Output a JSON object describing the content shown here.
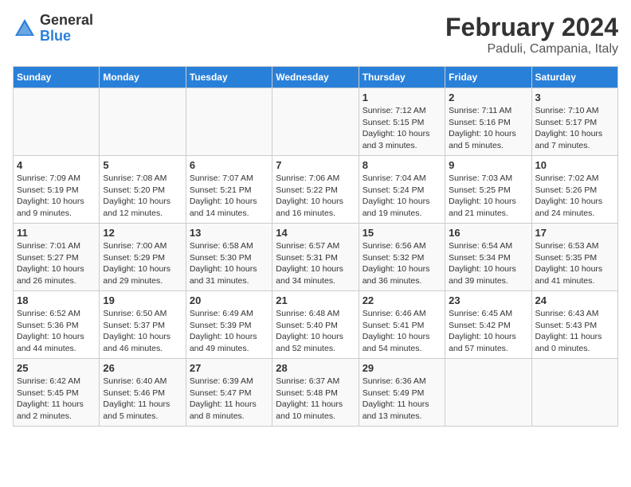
{
  "header": {
    "logo_line1": "General",
    "logo_line2": "Blue",
    "title": "February 2024",
    "subtitle": "Paduli, Campania, Italy"
  },
  "calendar": {
    "weekdays": [
      "Sunday",
      "Monday",
      "Tuesday",
      "Wednesday",
      "Thursday",
      "Friday",
      "Saturday"
    ],
    "weeks": [
      [
        {
          "day": "",
          "info": ""
        },
        {
          "day": "",
          "info": ""
        },
        {
          "day": "",
          "info": ""
        },
        {
          "day": "",
          "info": ""
        },
        {
          "day": "1",
          "info": "Sunrise: 7:12 AM\nSunset: 5:15 PM\nDaylight: 10 hours\nand 3 minutes."
        },
        {
          "day": "2",
          "info": "Sunrise: 7:11 AM\nSunset: 5:16 PM\nDaylight: 10 hours\nand 5 minutes."
        },
        {
          "day": "3",
          "info": "Sunrise: 7:10 AM\nSunset: 5:17 PM\nDaylight: 10 hours\nand 7 minutes."
        }
      ],
      [
        {
          "day": "4",
          "info": "Sunrise: 7:09 AM\nSunset: 5:19 PM\nDaylight: 10 hours\nand 9 minutes."
        },
        {
          "day": "5",
          "info": "Sunrise: 7:08 AM\nSunset: 5:20 PM\nDaylight: 10 hours\nand 12 minutes."
        },
        {
          "day": "6",
          "info": "Sunrise: 7:07 AM\nSunset: 5:21 PM\nDaylight: 10 hours\nand 14 minutes."
        },
        {
          "day": "7",
          "info": "Sunrise: 7:06 AM\nSunset: 5:22 PM\nDaylight: 10 hours\nand 16 minutes."
        },
        {
          "day": "8",
          "info": "Sunrise: 7:04 AM\nSunset: 5:24 PM\nDaylight: 10 hours\nand 19 minutes."
        },
        {
          "day": "9",
          "info": "Sunrise: 7:03 AM\nSunset: 5:25 PM\nDaylight: 10 hours\nand 21 minutes."
        },
        {
          "day": "10",
          "info": "Sunrise: 7:02 AM\nSunset: 5:26 PM\nDaylight: 10 hours\nand 24 minutes."
        }
      ],
      [
        {
          "day": "11",
          "info": "Sunrise: 7:01 AM\nSunset: 5:27 PM\nDaylight: 10 hours\nand 26 minutes."
        },
        {
          "day": "12",
          "info": "Sunrise: 7:00 AM\nSunset: 5:29 PM\nDaylight: 10 hours\nand 29 minutes."
        },
        {
          "day": "13",
          "info": "Sunrise: 6:58 AM\nSunset: 5:30 PM\nDaylight: 10 hours\nand 31 minutes."
        },
        {
          "day": "14",
          "info": "Sunrise: 6:57 AM\nSunset: 5:31 PM\nDaylight: 10 hours\nand 34 minutes."
        },
        {
          "day": "15",
          "info": "Sunrise: 6:56 AM\nSunset: 5:32 PM\nDaylight: 10 hours\nand 36 minutes."
        },
        {
          "day": "16",
          "info": "Sunrise: 6:54 AM\nSunset: 5:34 PM\nDaylight: 10 hours\nand 39 minutes."
        },
        {
          "day": "17",
          "info": "Sunrise: 6:53 AM\nSunset: 5:35 PM\nDaylight: 10 hours\nand 41 minutes."
        }
      ],
      [
        {
          "day": "18",
          "info": "Sunrise: 6:52 AM\nSunset: 5:36 PM\nDaylight: 10 hours\nand 44 minutes."
        },
        {
          "day": "19",
          "info": "Sunrise: 6:50 AM\nSunset: 5:37 PM\nDaylight: 10 hours\nand 46 minutes."
        },
        {
          "day": "20",
          "info": "Sunrise: 6:49 AM\nSunset: 5:39 PM\nDaylight: 10 hours\nand 49 minutes."
        },
        {
          "day": "21",
          "info": "Sunrise: 6:48 AM\nSunset: 5:40 PM\nDaylight: 10 hours\nand 52 minutes."
        },
        {
          "day": "22",
          "info": "Sunrise: 6:46 AM\nSunset: 5:41 PM\nDaylight: 10 hours\nand 54 minutes."
        },
        {
          "day": "23",
          "info": "Sunrise: 6:45 AM\nSunset: 5:42 PM\nDaylight: 10 hours\nand 57 minutes."
        },
        {
          "day": "24",
          "info": "Sunrise: 6:43 AM\nSunset: 5:43 PM\nDaylight: 11 hours\nand 0 minutes."
        }
      ],
      [
        {
          "day": "25",
          "info": "Sunrise: 6:42 AM\nSunset: 5:45 PM\nDaylight: 11 hours\nand 2 minutes."
        },
        {
          "day": "26",
          "info": "Sunrise: 6:40 AM\nSunset: 5:46 PM\nDaylight: 11 hours\nand 5 minutes."
        },
        {
          "day": "27",
          "info": "Sunrise: 6:39 AM\nSunset: 5:47 PM\nDaylight: 11 hours\nand 8 minutes."
        },
        {
          "day": "28",
          "info": "Sunrise: 6:37 AM\nSunset: 5:48 PM\nDaylight: 11 hours\nand 10 minutes."
        },
        {
          "day": "29",
          "info": "Sunrise: 6:36 AM\nSunset: 5:49 PM\nDaylight: 11 hours\nand 13 minutes."
        },
        {
          "day": "",
          "info": ""
        },
        {
          "day": "",
          "info": ""
        }
      ]
    ]
  }
}
